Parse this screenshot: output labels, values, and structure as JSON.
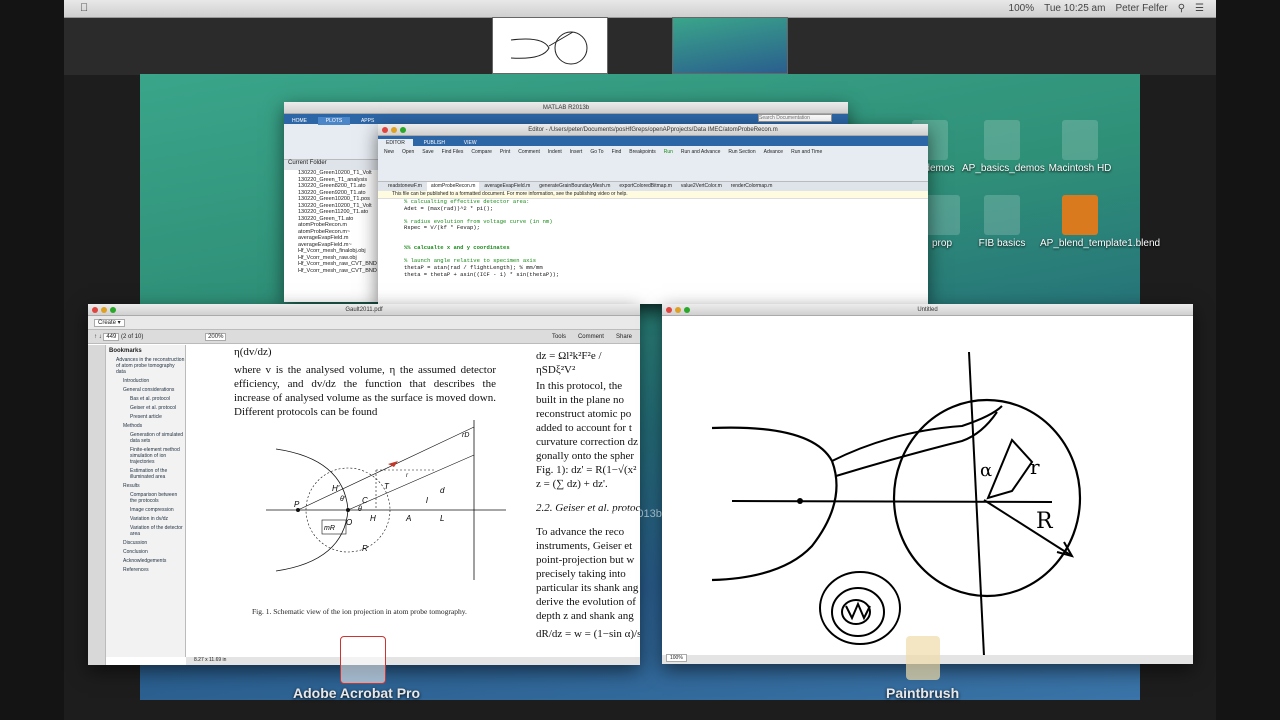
{
  "menubar": {
    "apple": "",
    "app_title": "Untitled",
    "status": {
      "battery": "100%",
      "clock": "Tue 10:25 am",
      "user": "Peter Felfer"
    }
  },
  "desktop_icons": [
    {
      "label": "doc demos"
    },
    {
      "label": "AP_basics_demos"
    },
    {
      "label": "Macintosh HD"
    },
    {
      "label": "prop"
    },
    {
      "label": "FIB basics"
    },
    {
      "label": "AP_blend_template1.blend"
    }
  ],
  "matlab": {
    "title": "MATLAB R2013b",
    "tabs": [
      "HOME",
      "PLOTS",
      "APPS"
    ],
    "search_placeholder": "Search Documentation",
    "current_folder_label": "Current Folder",
    "files": [
      "130220_Green10200_T1_Volt",
      "130220_Green_T1_analysis",
      "130220_Green8200_T1.ato",
      "130220_Green9200_T1.ato",
      "130220_Green10200_T1.pos",
      "130220_Green10200_T1_Volt",
      "130220_Green11200_T1.ato",
      "130220_Green_T1.ato",
      "atomProbeRecon.m",
      "atomProbeRecon.m~",
      "averageEvapField.m",
      "averageEvapField.m~",
      "Hf_Vcorr_mesh_finalobj.obj",
      "Hf_Vcorr_mesh_raw.obj",
      "Hf_Vcorr_mesh_raw_CVT_BND",
      "Hf_Vcorr_mesh_raw_CVT_BND"
    ]
  },
  "editor": {
    "title": "Editor - /Users/peter/Documents/posHfGreps/openAPprojects/Data IMEC/atomProbeRecon.m",
    "tabs": [
      "EDITOR",
      "PUBLISH",
      "VIEW"
    ],
    "toolbar": [
      "New",
      "Open",
      "Save",
      "Find Files",
      "Compare",
      "Print",
      "Comment",
      "Indent",
      "Insert",
      "Go To",
      "Find",
      "Breakpoints",
      "Run",
      "Run and Advance",
      "Run Section",
      "Advance",
      "Run and Time"
    ],
    "file_tabs": [
      "readstonewF.m",
      "atomProbeRecon.m",
      "averageEvapField.m",
      "generateGrainBoundaryMesh.m",
      "exportColoredBitmap.m",
      "value2VertColor.m",
      "renderColormap.m"
    ],
    "notice": "This file can be published to a formatted document. For more information, see the publishing video or help.",
    "lines": [
      {
        "n": "",
        "t": "% calcualting effective detector area:",
        "c": "comment"
      },
      {
        "n": "",
        "t": "Adet = (max(rad))^2 * pi();",
        "c": "code"
      },
      {
        "n": "",
        "t": "",
        "c": "code"
      },
      {
        "n": "",
        "t": "% radius evolution from voltage curve (in nm)",
        "c": "comment"
      },
      {
        "n": "",
        "t": "Rspec = V/(kf * Fevap);",
        "c": "code"
      },
      {
        "n": "",
        "t": "",
        "c": "code"
      },
      {
        "n": "",
        "t": "",
        "c": "code"
      },
      {
        "n": "",
        "t": "%% calcualte x and y coordinates",
        "c": "section"
      },
      {
        "n": "",
        "t": "",
        "c": "code"
      },
      {
        "n": "",
        "t": "% launch angle relative to specimen axis",
        "c": "comment"
      },
      {
        "n": "34",
        "t": "thetaP = atan(rad / flightLength); % mm/mm",
        "c": "code"
      },
      {
        "n": "35",
        "t": "theta = thetaP + asin((ICF - 1) * sin(thetaP));",
        "c": "code"
      },
      {
        "n": "36",
        "t": "",
        "c": "code"
      }
    ]
  },
  "acrobat": {
    "title": "Gault2011.pdf",
    "create_label": "Create",
    "page_current": "449",
    "page_total": "(2 of 10)",
    "zoom": "200%",
    "tools_links": [
      "Tools",
      "Comment",
      "Share"
    ],
    "bookmarks_title": "Bookmarks",
    "bookmarks": [
      {
        "label": "Advances in the reconstruction of atom probe tomography data",
        "level": 0
      },
      {
        "label": "Introduction",
        "level": 1
      },
      {
        "label": "General considerations",
        "level": 1
      },
      {
        "label": "Bas et al. protocol",
        "level": 2
      },
      {
        "label": "Geiser et al. protocol",
        "level": 2
      },
      {
        "label": "Present article",
        "level": 2
      },
      {
        "label": "Methods",
        "level": 1
      },
      {
        "label": "Generation of simulated data sets",
        "level": 2
      },
      {
        "label": "Finite-element method simulation of ion trajectories",
        "level": 2
      },
      {
        "label": "Estimation of the illuminated area",
        "level": 2
      },
      {
        "label": "Results",
        "level": 1
      },
      {
        "label": "Comparison between the protocols",
        "level": 2
      },
      {
        "label": "Image compression",
        "level": 2
      },
      {
        "label": "Variation in dv/dz",
        "level": 2
      },
      {
        "label": "Variation of the detector area",
        "level": 2
      },
      {
        "label": "Discussion",
        "level": 1
      },
      {
        "label": "Conclusion",
        "level": 1
      },
      {
        "label": "Acknowledgements",
        "level": 1
      },
      {
        "label": "References",
        "level": 1
      }
    ],
    "page_size": "8.27 x 11.69 in",
    "body_text": "where v is the analysed volume, η the assumed detector efficiency, and dv/dz the function that describes the increase of analysed volume as the surface is moved down. Different protocols can be found",
    "top_formula": "η(dv/dz)",
    "figure_caption": "Fig. 1. Schematic view of the ion projection in atom probe tomography.",
    "right_col": [
      "In this protocol, the",
      "built in the plane no",
      "reconstruct atomic po",
      "added to account for t",
      "curvature correction dz",
      "gonally onto the spher",
      "Fig. 1): dz' = R(1−√(x²",
      "z = (∑ dz) + dz'."
    ],
    "section_heading": "2.2. Geiser et al. protoc",
    "right_col2": [
      "To advance the reco",
      "instruments, Geiser et",
      "point-projection but w",
      "precisely taking into",
      "particular its shank ang",
      "derive the evolution of",
      "depth z and shank ang"
    ],
    "dz_formula": "dz = Ωl²k²F²e / ηSDξ²V²",
    "dr_formula": "dR/dz = w = (1−sin α)/sin α",
    "fig_labels": [
      "P",
      "O",
      "C",
      "H'",
      "H",
      "A",
      "T",
      "r",
      "θ",
      "θ'",
      "mR",
      "R",
      "d",
      "L",
      "l",
      "rD"
    ]
  },
  "paintbrush": {
    "title": "Untitled",
    "zoom": "100%",
    "drawing_labels": [
      "α",
      "r",
      "R"
    ]
  },
  "dock": {
    "acrobat_label": "Adobe Acrobat Pro",
    "paintbrush_label": "Paintbrush",
    "watermark": "MATLAB_R2013b"
  }
}
